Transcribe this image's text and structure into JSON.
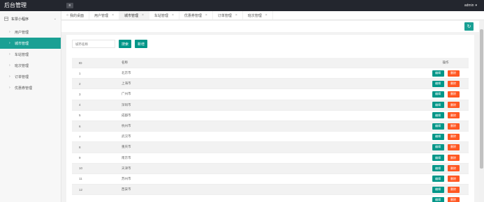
{
  "header": {
    "logo": "后台管理",
    "menu_icon": "≡",
    "user_label": "admin",
    "user_caret": "▾"
  },
  "sidebar": {
    "group_label": "车票小程序",
    "group_caret": "⌄",
    "items": [
      {
        "label": "用户管理",
        "active": false
      },
      {
        "label": "城市管理",
        "active": true
      },
      {
        "label": "车站管理",
        "active": false
      },
      {
        "label": "班次管理",
        "active": false
      },
      {
        "label": "订单管理",
        "active": false
      },
      {
        "label": "优惠券管理",
        "active": false
      }
    ]
  },
  "tabs": [
    {
      "label": "我的桌面",
      "active": false,
      "closable": false
    },
    {
      "label": "用户管理",
      "active": false,
      "closable": true
    },
    {
      "label": "城市管理",
      "active": true,
      "closable": true
    },
    {
      "label": "车站管理",
      "active": false,
      "closable": true
    },
    {
      "label": "优惠券管理",
      "active": false,
      "closable": true
    },
    {
      "label": "订单管理",
      "active": false,
      "closable": true
    },
    {
      "label": "班次管理",
      "active": false,
      "closable": true
    }
  ],
  "toolbar": {
    "refresh_icon": "↻"
  },
  "search": {
    "placeholder": "城市名称",
    "search_label": "搜索",
    "add_label": "新增"
  },
  "table": {
    "headers": {
      "id": "ID",
      "name": "名称",
      "ops": "操作"
    },
    "edit_label": "编辑",
    "delete_label": "删除",
    "rows": [
      {
        "id": "1",
        "name": "北京市"
      },
      {
        "id": "2",
        "name": "上海市"
      },
      {
        "id": "3",
        "name": "广州市"
      },
      {
        "id": "4",
        "name": "深圳市"
      },
      {
        "id": "5",
        "name": "成都市"
      },
      {
        "id": "6",
        "name": "杭州市"
      },
      {
        "id": "7",
        "name": "武汉市"
      },
      {
        "id": "8",
        "name": "重庆市"
      },
      {
        "id": "9",
        "name": "南京市"
      },
      {
        "id": "10",
        "name": "天津市"
      },
      {
        "id": "11",
        "name": "苏州市"
      },
      {
        "id": "12",
        "name": "西安市"
      },
      {
        "id": "",
        "name": ""
      }
    ]
  },
  "colors": {
    "topbar": "#23262e",
    "accent": "#009688",
    "sidebar_active": "#1aa094",
    "danger": "#ff5722"
  }
}
